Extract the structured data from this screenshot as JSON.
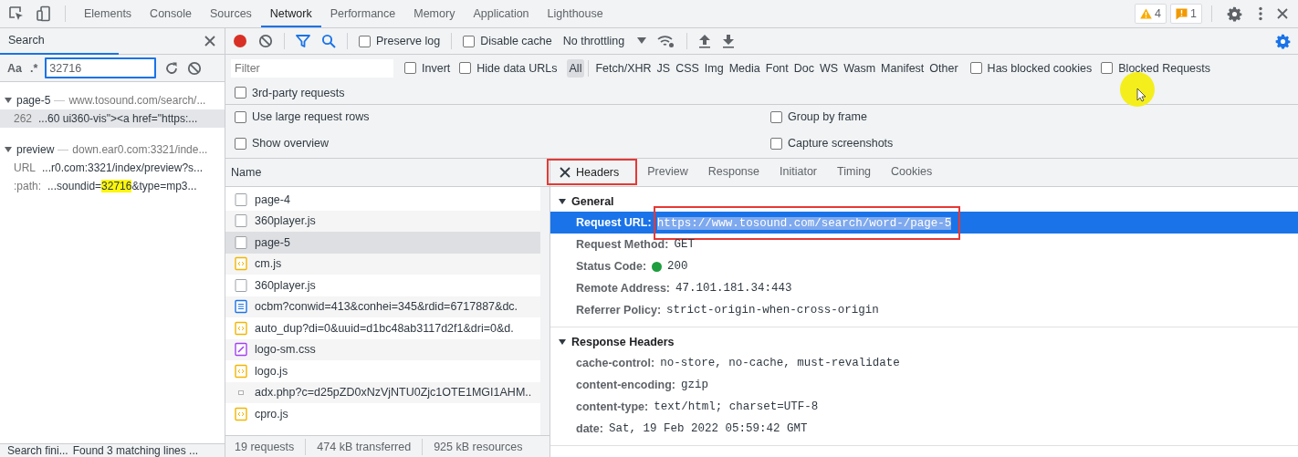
{
  "top_bar": {
    "tabs": [
      {
        "label": "Elements",
        "selected": false
      },
      {
        "label": "Console",
        "selected": false
      },
      {
        "label": "Sources",
        "selected": false
      },
      {
        "label": "Network",
        "selected": true
      },
      {
        "label": "Performance",
        "selected": false
      },
      {
        "label": "Memory",
        "selected": false
      },
      {
        "label": "Application",
        "selected": false
      },
      {
        "label": "Lighthouse",
        "selected": false
      }
    ],
    "warnings": "4",
    "issues": "1"
  },
  "search": {
    "title": "Search",
    "match_case": "Aa",
    "regex": ".*",
    "query": "32716",
    "results": [
      {
        "name": "page-5",
        "url": "www.tosound.com/search/...",
        "expanded": true,
        "matches": [
          {
            "label": "262",
            "selected": true,
            "segments": [
              {
                "text": "...60 ui360-vis\"><a href=\"https:...",
                "highlighted": false
              }
            ]
          }
        ]
      },
      {
        "name": "preview",
        "url": "down.ear0.com:3321/inde...",
        "expanded": true,
        "matches": [
          {
            "label": "URL",
            "selected": false,
            "segments": [
              {
                "text": "...r0.com:3321/index/preview?s...",
                "highlighted": false
              }
            ]
          },
          {
            "label": ":path:",
            "selected": false,
            "segments": [
              {
                "text": "...soundid=",
                "highlighted": false
              },
              {
                "text": "32716",
                "highlighted": true
              },
              {
                "text": "&type=mp3...",
                "highlighted": false
              }
            ]
          }
        ]
      }
    ],
    "status": [
      "Search fini...",
      "Found 3 matching lines ..."
    ]
  },
  "network": {
    "recording": true,
    "preserve_log": {
      "label": "Preserve log",
      "checked": false
    },
    "disable_cache": {
      "label": "Disable cache",
      "checked": false
    },
    "throttling": "No throttling",
    "filter": {
      "placeholder": "Filter"
    },
    "invert": {
      "label": "Invert",
      "checked": false
    },
    "hide_data_urls": {
      "label": "Hide data URLs",
      "checked": false
    },
    "types": [
      {
        "label": "All",
        "selected": true
      },
      {
        "label": "Fetch/XHR",
        "selected": false
      },
      {
        "label": "JS",
        "selected": false
      },
      {
        "label": "CSS",
        "selected": false
      },
      {
        "label": "Img",
        "selected": false
      },
      {
        "label": "Media",
        "selected": false
      },
      {
        "label": "Font",
        "selected": false
      },
      {
        "label": "Doc",
        "selected": false
      },
      {
        "label": "WS",
        "selected": false
      },
      {
        "label": "Wasm",
        "selected": false
      },
      {
        "label": "Manifest",
        "selected": false
      },
      {
        "label": "Other",
        "selected": false
      }
    ],
    "has_blocked_cookies": {
      "label": "Has blocked cookies",
      "checked": false
    },
    "blocked_requests": {
      "label": "Blocked Requests",
      "checked": false
    },
    "third_party": {
      "label": "3rd-party requests",
      "checked": false
    },
    "options": [
      {
        "label": "Use large request rows",
        "checked": false
      },
      {
        "label": "Group by frame",
        "checked": false
      },
      {
        "label": "Show overview",
        "checked": false
      },
      {
        "label": "Capture screenshots",
        "checked": false
      }
    ],
    "requests": {
      "column": "Name",
      "rows": [
        {
          "name": "page-4",
          "kind": "document",
          "selected": false
        },
        {
          "name": "360player.js",
          "kind": "document",
          "selected": false
        },
        {
          "name": "page-5",
          "kind": "document",
          "selected": true
        },
        {
          "name": "cm.js",
          "kind": "script",
          "selected": false
        },
        {
          "name": "360player.js",
          "kind": "document",
          "selected": false
        },
        {
          "name": "ocbm?conwid=413&conhei=345&rdid=6717887&dc.",
          "kind": "feed",
          "selected": false
        },
        {
          "name": "auto_dup?di=0&uuid=d1bc48ab3117d2f1&dri=0&d.",
          "kind": "script",
          "selected": false
        },
        {
          "name": "logo-sm.css",
          "kind": "style",
          "selected": false
        },
        {
          "name": "logo.js",
          "kind": "script",
          "selected": false
        },
        {
          "name": "adx.php?c=d25pZD0xNzVjNTU0Zjc1OTE1MGI1AHM..",
          "kind": "pixel",
          "selected": false
        },
        {
          "name": "cpro.js",
          "kind": "script",
          "selected": false
        }
      ],
      "status": [
        "19 requests",
        "474 kB transferred",
        "925 kB resources"
      ]
    },
    "details": {
      "tabs": [
        {
          "label": "Headers",
          "selected": true,
          "outlined": true
        },
        {
          "label": "Preview",
          "selected": false,
          "outlined": false
        },
        {
          "label": "Response",
          "selected": false,
          "outlined": false
        },
        {
          "label": "Initiator",
          "selected": false,
          "outlined": false
        },
        {
          "label": "Timing",
          "selected": false,
          "outlined": false
        },
        {
          "label": "Cookies",
          "selected": false,
          "outlined": false
        }
      ],
      "sections": [
        {
          "title": "General",
          "expanded": true,
          "rows": [
            {
              "key": "Request URL:",
              "value": "https://www.tosound.com/search/word-/page-5",
              "kind": "plain",
              "selected": true,
              "outlined": true
            },
            {
              "key": "Request Method:",
              "value": "GET",
              "kind": "plain",
              "selected": false,
              "outlined": false
            },
            {
              "key": "Status Code:",
              "value": "200",
              "kind": "status",
              "selected": false,
              "outlined": false
            },
            {
              "key": "Remote Address:",
              "value": "47.101.181.34:443",
              "kind": "plain",
              "selected": false,
              "outlined": false
            },
            {
              "key": "Referrer Policy:",
              "value": "strict-origin-when-cross-origin",
              "kind": "plain",
              "selected": false,
              "outlined": false
            }
          ]
        },
        {
          "title": "Response Headers",
          "expanded": true,
          "rows": [
            {
              "key": "cache-control:",
              "value": "no-store, no-cache, must-revalidate",
              "kind": "plain",
              "selected": false,
              "outlined": false
            },
            {
              "key": "content-encoding:",
              "value": "gzip",
              "kind": "plain",
              "selected": false,
              "outlined": false
            },
            {
              "key": "content-type:",
              "value": "text/html; charset=UTF-8",
              "kind": "plain",
              "selected": false,
              "outlined": false
            },
            {
              "key": "date:",
              "value": "Sat, 19 Feb 2022 05:59:42 GMT",
              "kind": "plain",
              "selected": false,
              "outlined": false
            }
          ]
        }
      ]
    }
  }
}
